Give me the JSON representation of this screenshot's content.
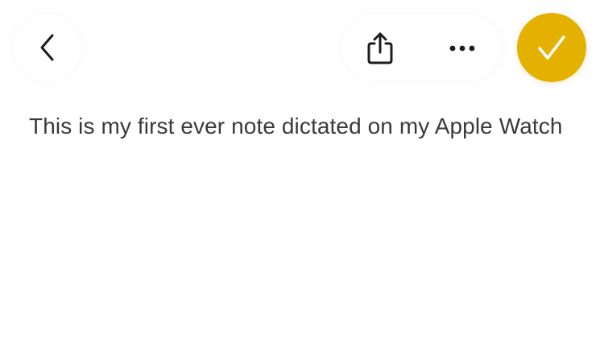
{
  "note": {
    "text": "This is my first ever note dictated on my Apple Watch"
  },
  "toolbar": {
    "back_icon": "chevron-left-icon",
    "share_icon": "share-icon",
    "more_icon": "ellipsis-icon",
    "done_icon": "checkmark-icon"
  },
  "colors": {
    "accent": "#e5b100",
    "text": "#3a3a3a",
    "icon": "#1c1c1e",
    "background": "#ffffff"
  }
}
